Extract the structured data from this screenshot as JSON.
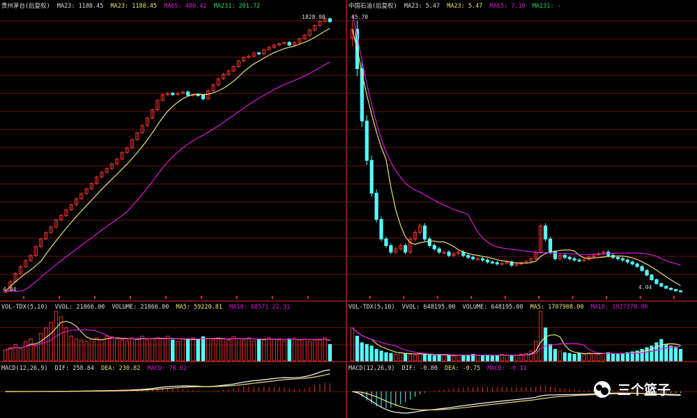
{
  "left": {
    "main_header": {
      "name": "贵州茅台(后复权)",
      "ma23": "MA23: 1188.45",
      "ma23b": "MA23: 1188.45",
      "ma65": "MA65: 480.42",
      "ma231": "MA231: 201.72"
    },
    "high_label": "1828.00",
    "low_label": "4.04",
    "vol_header": {
      "name": "VOL-TDX(5,10)",
      "vvol": "VVOL: 21866.00",
      "volume": "VOLUME: 21866.00",
      "ma5": "MA5: 59220.81",
      "ma10": "MA10: 68571.22.31"
    },
    "macd_header": {
      "name": "MACD(12,26,9)",
      "dif": "DIF: 258.84",
      "dea": "DEA: 230.82",
      "macd": "MACD: 78.02"
    }
  },
  "right": {
    "main_header": {
      "name": "中国石油(后复权)",
      "ma23": "MA23: 5.47",
      "ma23b": "MA23: 5.47",
      "ma65": "MA65: 7.10",
      "ma231": "MA231: -"
    },
    "high_label": "45.70",
    "low_label": "4.04",
    "vol_header": {
      "name": "VOL-TDX(5,10)",
      "vvol": "VVOL: 648195.00",
      "volume": "VOLUME: 648195.00",
      "ma5": "MA5: 1707908.00",
      "ma10": "MA10: 1927378.00"
    },
    "macd_header": {
      "name": "MACD(12,26,9)",
      "dif": "DIF: -0.80",
      "dea": "DEA: -0.75",
      "macd": "MACD: -0.11"
    }
  },
  "watermark": {
    "text": "三个篮子"
  },
  "colors": {
    "up": "#e8322d",
    "down": "#54ffff",
    "ma_short": "#e8e37a",
    "ma_long": "#d81ad6",
    "dif": "#ffffff",
    "dea": "#e8e37a",
    "grid": "#6a1212",
    "header_white": "#dddddd"
  },
  "chart_data": [
    {
      "type": "candlestick",
      "title": "贵州茅台(后复权)",
      "description_of_trend": "long uptrend from about 4 to about 1828",
      "ylim": [
        4.04,
        1828.0
      ],
      "close": [
        4,
        5,
        6,
        7,
        8,
        9,
        11,
        13,
        15,
        17,
        20,
        22,
        25,
        28,
        32,
        36,
        40,
        45,
        52,
        58,
        63,
        70,
        78,
        90,
        100,
        120,
        140,
        165,
        195,
        235,
        290,
        330,
        340,
        330,
        340,
        350,
        325,
        330,
        325,
        300,
        360,
        410,
        470,
        520,
        560,
        620,
        700,
        760,
        780,
        840,
        820,
        900,
        950,
        1000,
        1030,
        1060,
        1000,
        1060,
        1150,
        1250,
        1400,
        1550,
        1700,
        1800,
        1690
      ],
      "vol": [
        20,
        24,
        30,
        22,
        35,
        40,
        28,
        50,
        60,
        70,
        90,
        80,
        60,
        45,
        40,
        38,
        35,
        40,
        42,
        38,
        45,
        44,
        40,
        38,
        36,
        42,
        40,
        45,
        38,
        40,
        42,
        40,
        45,
        38,
        36,
        40,
        38,
        42,
        40,
        44,
        40,
        38,
        42,
        40,
        38,
        44,
        40,
        38,
        42,
        36,
        40,
        38,
        42,
        40,
        38,
        36,
        40,
        42,
        38,
        40,
        36,
        38,
        40,
        42,
        30
      ]
    },
    {
      "type": "candlestick",
      "title": "中国石油(后复权)",
      "description_of_trend": "peak at listing (45.70) then long decline to about 4.04",
      "ylim": [
        4.04,
        45.7
      ],
      "close": [
        44,
        38,
        30,
        24,
        19,
        15,
        12,
        11,
        10,
        10.5,
        11,
        10,
        12,
        13,
        14,
        12,
        11,
        10.5,
        10,
        10,
        9.5,
        9.8,
        10,
        9.5,
        9.2,
        9,
        9,
        8.8,
        8.5,
        8.4,
        8.2,
        8.3,
        8.5,
        8,
        8.2,
        8.4,
        8.6,
        9,
        10,
        14,
        12,
        10,
        9,
        9.5,
        9.2,
        9,
        8.8,
        8.7,
        8.9,
        9.3,
        9.6,
        9.8,
        10,
        9.5,
        9.2,
        9,
        8.8,
        8.5,
        8.2,
        7.8,
        7.2,
        6.5,
        5.8,
        5.2,
        4.8,
        4.5,
        4.3,
        4.1,
        4.04
      ],
      "vol": [
        40,
        30,
        22,
        20,
        18,
        14,
        12,
        10,
        9,
        8,
        10,
        9,
        8,
        7,
        9,
        8,
        7,
        6,
        7,
        8,
        7,
        6,
        7,
        6,
        7,
        8,
        7,
        6,
        7,
        6,
        7,
        8,
        7,
        6,
        7,
        8,
        9,
        12,
        24,
        60,
        40,
        20,
        14,
        12,
        10,
        9,
        8,
        9,
        8,
        10,
        9,
        8,
        9,
        10,
        9,
        8,
        9,
        10,
        11,
        12,
        14,
        16,
        18,
        22,
        26,
        20,
        18,
        16,
        14
      ]
    }
  ]
}
